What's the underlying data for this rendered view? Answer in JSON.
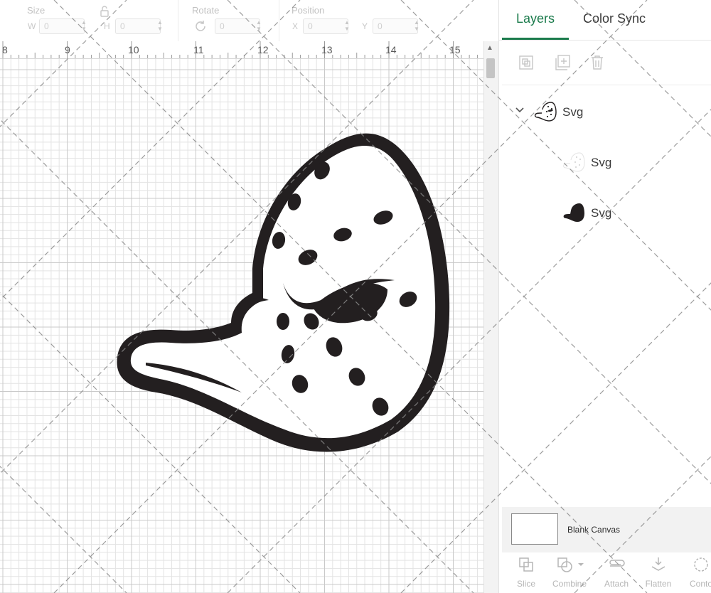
{
  "toolbar": {
    "size_label": "Size",
    "w_label": "W",
    "w_value": "0",
    "h_label": "H",
    "h_value": "0",
    "rotate_label": "Rotate",
    "rotate_value": "0",
    "position_label": "Position",
    "x_label": "X",
    "x_value": "0",
    "y_label": "Y",
    "y_value": "0"
  },
  "ruler": {
    "ticks": [
      "8",
      "9",
      "10",
      "11",
      "12",
      "13",
      "14",
      "15"
    ]
  },
  "panel": {
    "tabs": [
      {
        "label": "Layers",
        "active": true
      },
      {
        "label": "Color Sync",
        "active": false
      }
    ],
    "layer_tools": [
      "group-icon",
      "duplicate-icon",
      "delete-icon"
    ],
    "layers": [
      {
        "name": "Svg",
        "expanded": true,
        "thumbnail": "duck-mask-icon"
      },
      {
        "name": "Svg",
        "thumbnail": "duck-mask-dots-icon"
      },
      {
        "name": "Svg",
        "thumbnail": "duck-mask-silhouette-icon"
      }
    ],
    "blank_canvas": {
      "label": "Blank Canvas"
    },
    "bottom_tools": [
      "Slice",
      "Combine",
      "Attach",
      "Flatten",
      "Conto"
    ]
  },
  "colors": {
    "accent": "#1b7b4c",
    "design_fill": "#231f20"
  }
}
